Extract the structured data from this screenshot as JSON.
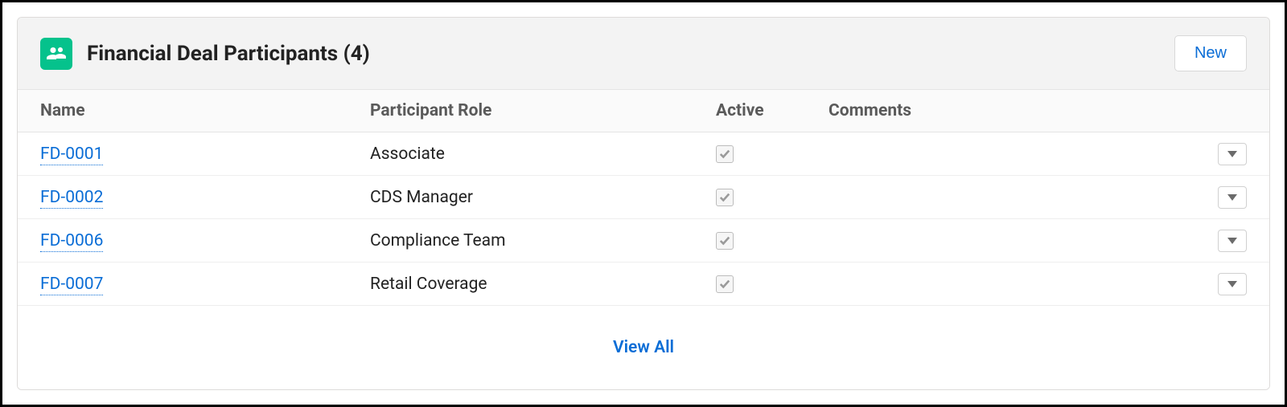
{
  "header": {
    "title": "Financial Deal Participants (4)",
    "new_button": "New"
  },
  "columns": {
    "name": "Name",
    "role": "Participant Role",
    "active": "Active",
    "comments": "Comments"
  },
  "rows": [
    {
      "name": "FD-0001",
      "role": "Associate",
      "active": true,
      "comments": ""
    },
    {
      "name": "FD-0002",
      "role": "CDS Manager",
      "active": true,
      "comments": ""
    },
    {
      "name": "FD-0006",
      "role": "Compliance Team",
      "active": true,
      "comments": ""
    },
    {
      "name": "FD-0007",
      "role": "Retail Coverage",
      "active": true,
      "comments": ""
    }
  ],
  "footer": {
    "view_all": "View All"
  }
}
